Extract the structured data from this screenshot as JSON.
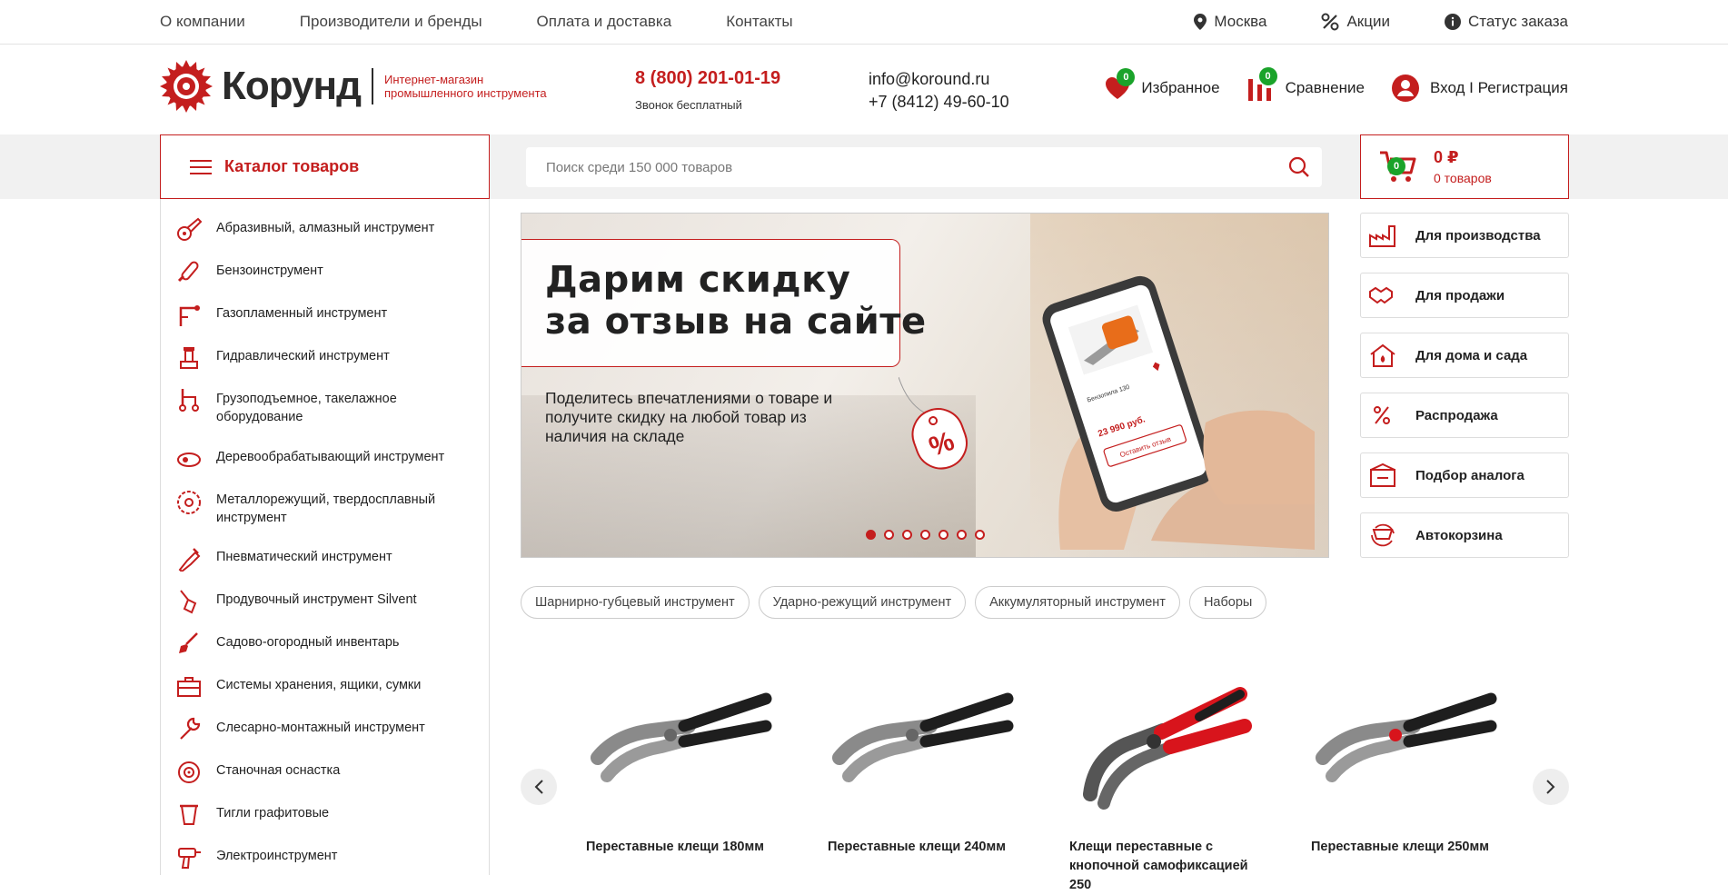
{
  "topnav": {
    "links": [
      "О компании",
      "Производители и бренды",
      "Оплата и доставка",
      "Контакты"
    ],
    "city": "Москва",
    "promo": "Акции",
    "order_status": "Статус заказа"
  },
  "header": {
    "logo_name": "Корунд",
    "logo_tagline": "Интернет-магазин промышленного инструмента",
    "phone": "8 (800) 201-01-19",
    "phone_note": "Звонок бесплатный",
    "email": "info@koround.ru",
    "phone2": "+7 (8412) 49-60-10",
    "favorites_label": "Избранное",
    "favorites_count": "0",
    "compare_label": "Сравнение",
    "compare_count": "0",
    "login_label": "Вход I Регистрация"
  },
  "catalog": {
    "button_label": "Каталог товаров"
  },
  "search": {
    "placeholder": "Поиск среди 150 000 товаров"
  },
  "cart": {
    "sum": "0 ₽",
    "count_text": "0 товаров",
    "badge": "0"
  },
  "sidebar": {
    "items": [
      {
        "label": "Абразивный, алмазный инструмент",
        "icon": "grinder-icon"
      },
      {
        "label": "Бензоинструмент",
        "icon": "chainsaw-icon"
      },
      {
        "label": "Газопламенный инструмент",
        "icon": "torch-icon"
      },
      {
        "label": "Гидравлический инструмент",
        "icon": "hydraulic-jack-icon"
      },
      {
        "label": "Грузоподъемное, такелажное оборудование",
        "icon": "hoist-icon"
      },
      {
        "label": "Деревообрабатывающий инструмент",
        "icon": "planer-icon"
      },
      {
        "label": "Металлорежущий, твердосплавный инструмент",
        "icon": "saw-blade-icon"
      },
      {
        "label": "Пневматический инструмент",
        "icon": "pneumatic-gun-icon"
      },
      {
        "label": "Продувочный инструмент Silvent",
        "icon": "blow-gun-icon"
      },
      {
        "label": "Садово-огородный инвентарь",
        "icon": "shovel-icon"
      },
      {
        "label": "Системы хранения, ящики, сумки",
        "icon": "toolbox-icon"
      },
      {
        "label": "Слесарно-монтажный инструмент",
        "icon": "wrench-icon"
      },
      {
        "label": "Станочная оснастка",
        "icon": "chuck-icon"
      },
      {
        "label": "Тигли графитовые",
        "icon": "crucible-icon"
      },
      {
        "label": "Электроинструмент",
        "icon": "drill-icon"
      }
    ]
  },
  "banner": {
    "title_line1": "Дарим скидку",
    "title_line2": "за отзыв на сайте",
    "text": "Поделитесь впечатлениями о товаре и получите скидку на любой товар из наличия на складе",
    "tag_symbol": "%",
    "phone_screen": {
      "product_name": "Бензопила 130",
      "price": "23 990 руб.",
      "button": "Оставить отзыв"
    },
    "slides_total": 7,
    "active_slide": 1
  },
  "right_buttons": [
    {
      "label": "Для производства",
      "icon": "factory-icon"
    },
    {
      "label": "Для продажи",
      "icon": "handshake-icon"
    },
    {
      "label": "Для дома и сада",
      "icon": "house-icon"
    },
    {
      "label": "Распродажа",
      "icon": "percent-icon"
    },
    {
      "label": "Подбор аналога",
      "icon": "analog-box-icon"
    },
    {
      "label": "Автокорзина",
      "icon": "auto-cart-icon"
    }
  ],
  "chips": [
    "Шарнирно-губцевый инструмент",
    "Ударно-режущий инструмент",
    "Аккумуляторный инструмент",
    "Наборы"
  ],
  "products": [
    {
      "name": "Переставные клещи 180мм",
      "handle_color": "#1e1e1e"
    },
    {
      "name": "Переставные клещи 240мм",
      "handle_color": "#1e1e1e"
    },
    {
      "name": "Клещи переставные с кнопочной самофиксацией 250",
      "handle_color": "#d8141c"
    },
    {
      "name": "Переставные клещи 250мм",
      "handle_color": "#1e1e1e"
    }
  ],
  "colors": {
    "accent": "#c41e1e",
    "badge": "#1aa32a",
    "strip": "#f1f1f1"
  }
}
